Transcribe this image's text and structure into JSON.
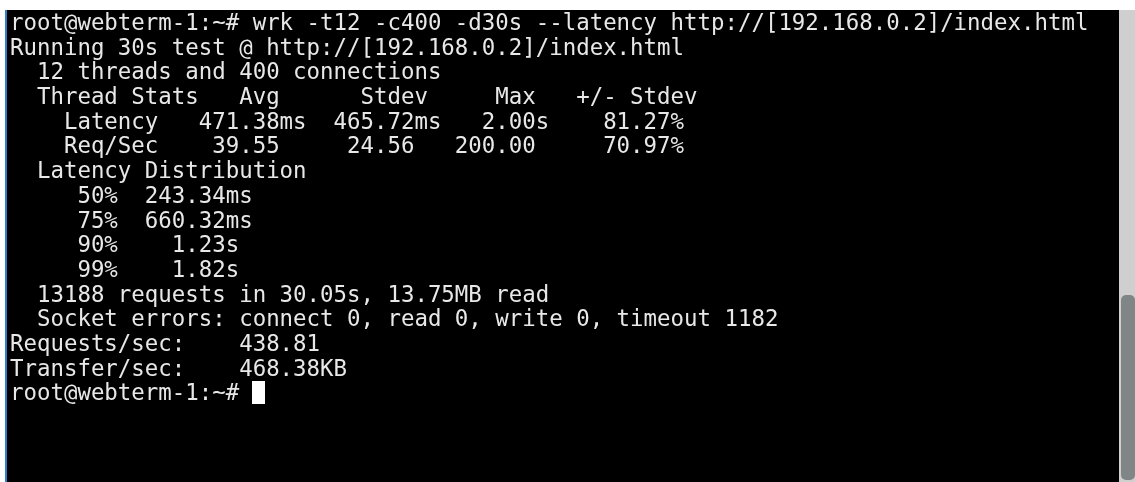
{
  "terminal": {
    "lines": [
      "root@webterm-1:~# wrk -t12 -c400 -d30s --latency http://[192.168.0.2]/index.html",
      "Running 30s test @ http://[192.168.0.2]/index.html",
      "  12 threads and 400 connections",
      "  Thread Stats   Avg      Stdev     Max   +/- Stdev",
      "    Latency   471.38ms  465.72ms   2.00s    81.27%",
      "    Req/Sec    39.55     24.56   200.00     70.97%",
      "  Latency Distribution",
      "     50%  243.34ms",
      "     75%  660.32ms",
      "     90%    1.23s",
      "     99%    1.82s",
      "  13188 requests in 30.05s, 13.75MB read",
      "  Socket errors: connect 0, read 0, write 0, timeout 1182",
      "Requests/sec:    438.81",
      "Transfer/sec:    468.38KB"
    ],
    "prompt": "root@webterm-1:~#"
  }
}
